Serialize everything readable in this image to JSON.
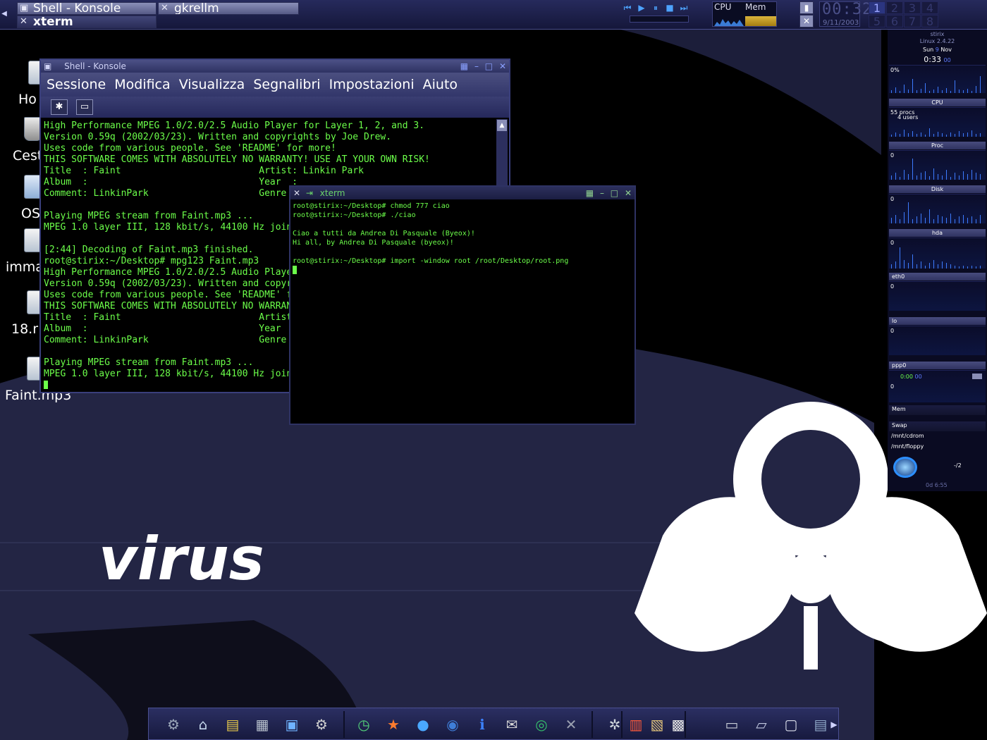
{
  "taskbar": {
    "tasks": [
      {
        "label": "Shell - Konsole"
      },
      {
        "label": "gkrellm"
      },
      {
        "label": "xterm"
      }
    ],
    "media_controls": [
      "prev",
      "play",
      "pause",
      "stop",
      "next"
    ],
    "monitor": {
      "cpu_label": "CPU",
      "mem_label": "Mem"
    },
    "clock": {
      "time": "00:32",
      "date": "9/11/2003"
    },
    "pager": [
      "1",
      "2",
      "3",
      "4",
      "5",
      "6",
      "7",
      "8"
    ]
  },
  "desktop": {
    "icons": [
      {
        "label": "Ho",
        "icon": "home-icon"
      },
      {
        "label": "Cest",
        "icon": "trash-icon"
      },
      {
        "label": "OS",
        "icon": "folder-icon"
      },
      {
        "label": "imma",
        "icon": "file-icon"
      },
      {
        "label": "18.r",
        "icon": "audio-file-icon"
      },
      {
        "label": "Faint.mp3",
        "icon": "audio-file-icon"
      }
    ],
    "wallpaper_text": "virus"
  },
  "konsole": {
    "title": "Shell - Konsole",
    "menu": [
      "Sessione",
      "Modifica",
      "Visualizza",
      "Segnalibri",
      "Impostazioni",
      "Aiuto"
    ],
    "lines": [
      "High Performance MPEG 1.0/2.0/2.5 Audio Player for Layer 1, 2, and 3.",
      "Version 0.59q (2002/03/23). Written and copyrights by Joe Drew.",
      "Uses code from various people. See 'README' for more!",
      "THIS SOFTWARE COMES WITH ABSOLUTELY NO WARRANTY! USE AT YOUR OWN RISK!",
      "Title  : Faint                         Artist: Linkin Park",
      "Album  :                               Year  :",
      "Comment: LinkinPark                    Genre :",
      "",
      "Playing MPEG stream from Faint.mp3 ...",
      "MPEG 1.0 layer III, 128 kbit/s, 44100 Hz joint-stereo",
      "",
      "[2:44] Decoding of Faint.mp3 finished.",
      "root@stirix:~/Desktop# mpg123 Faint.mp3",
      "High Performance MPEG 1.0/2.0/2.5 Audio Player for Layer 1, 2, and 3.",
      "Version 0.59q (2002/03/23). Written and copyrights by Joe Drew.",
      "Uses code from various people. See 'README' for more!",
      "THIS SOFTWARE COMES WITH ABSOLUTELY NO WARRANTY! USE AT YOUR OWN RISK!",
      "Title  : Faint                         Artist: Linkin Park",
      "Album  :                               Year  :",
      "Comment: LinkinPark                    Genre :",
      "",
      "Playing MPEG stream from Faint.mp3 ...",
      "MPEG 1.0 layer III, 128 kbit/s, 44100 Hz joint-stereo"
    ]
  },
  "xterm": {
    "title": "xterm",
    "lines": [
      "root@stirix:~/Desktop# chmod 777 ciao",
      "root@stirix:~/Desktop# ./ciao",
      "",
      "Ciao a tutti da Andrea Di Pasquale (Byeox)!",
      "Hi all, by Andrea Di Pasquale (byeox)!",
      "",
      "root@stirix:~/Desktop# import -window root /root/Desktop/root.png"
    ]
  },
  "gkrellm": {
    "hostname": "stirix",
    "kernel": "Linux 2.4.22",
    "day": "Sun",
    "date_num": "9",
    "month": "Nov",
    "time": "0:33",
    "seconds": "00",
    "cpu_pct": "0%",
    "procs": "55 procs",
    "users": "4 users",
    "panels": [
      "CPU",
      "Proc",
      "Disk",
      "hda",
      "eth0",
      "lo",
      "ppp0"
    ],
    "zero": "0",
    "ppp_time": "0:00",
    "ppp_sec": "00",
    "mem_label": "Mem",
    "swap_label": "Swap",
    "mounts": [
      "/mnt/cdrom",
      "/mnt/floppy"
    ],
    "mail_count": "-/2",
    "uptime": "0d 6:55"
  },
  "dock": {
    "icons": [
      "control-center-icon",
      "home-folder-icon",
      "terminal-panel-icon",
      "film-icon",
      "desktop-icon",
      "settings-icon",
      "clock-icon",
      "star-icon",
      "globe-icon",
      "earth-icon",
      "info-icon",
      "mail-icon",
      "browser-icon",
      "x-icon",
      "cleanup-icon",
      "notes-icon",
      "clipboard-icon",
      "calculator-icon",
      "monitor-icon",
      "laptop-icon",
      "window-icon",
      "floppy-icon"
    ]
  }
}
